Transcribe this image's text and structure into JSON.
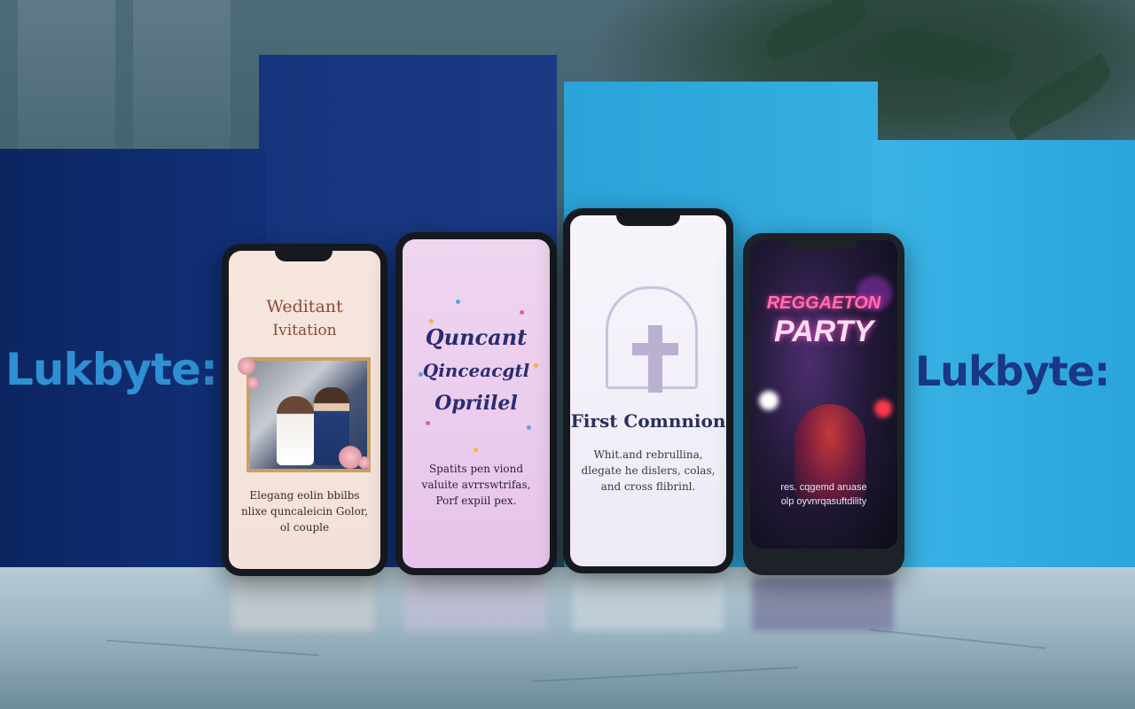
{
  "brand": {
    "left_label": "Lukbyte:",
    "right_label": "Lukbyte:"
  },
  "phones": [
    {
      "title_line1": "Weditant",
      "title_line2": "Ivitation",
      "caption_line1": "Elegang eolin bbilbs",
      "caption_line2": "nlixe quncaleicin Golor,",
      "caption_line3": "ol couple"
    },
    {
      "title_line1": "Quncant",
      "title_line2": "Qinceacgtl",
      "title_line3": "Opriilel",
      "caption_line1": "Spatits pen viond",
      "caption_line2": "valuite avrrswtrifas,",
      "caption_line3": "Porf expiil pex."
    },
    {
      "title": "First Comnnion",
      "caption_line1": "Whit.and rebrullina,",
      "caption_line2": "dlegate he dislers, colas,",
      "caption_line3": "and cross flibrinl."
    },
    {
      "title_line1": "REGGAETON",
      "title_line2": "PARTY",
      "caption_line1": "res. cqgemd aruase",
      "caption_line2": "olp oyvnrqasuftdility"
    }
  ],
  "colors": {
    "navy": "#12307a",
    "sky": "#35aee1",
    "brand_left": "#2f8fd3",
    "brand_right": "#1a3785"
  }
}
